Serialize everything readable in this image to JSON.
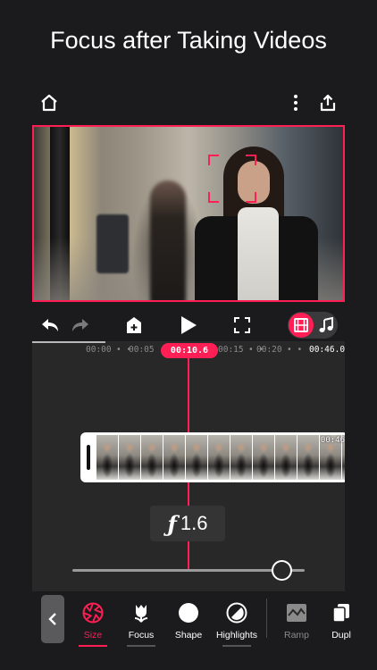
{
  "headline": "Focus after Taking Videos",
  "icons": {
    "home": "home-icon",
    "more": "more-vertical-icon",
    "share": "share-icon",
    "undo": "undo-icon",
    "redo": "redo-icon",
    "add_clip": "add-clip-icon",
    "play": "play-icon",
    "fullscreen": "fullscreen-icon",
    "film": "film-icon",
    "music": "music-note-icon",
    "back": "chevron-left-icon"
  },
  "colors": {
    "accent": "#ff1f55",
    "background": "#1b1b1d",
    "timeline_bg": "#282828"
  },
  "timeline": {
    "ruler": {
      "t0": "00:00",
      "t5": "00:05",
      "t15": "00:15",
      "t20": "00:20",
      "end": "00:46.0"
    },
    "current_time": "00:10.6",
    "clip_duration": "00:46",
    "aperture_symbol": "ƒ",
    "aperture_value": "1.6",
    "slider_value_fraction": 0.92
  },
  "tools": {
    "size": "Size",
    "focus": "Focus",
    "shape": "Shape",
    "highlights": "Highlights",
    "ramp": "Ramp",
    "duplicate": "Dupl"
  },
  "active_tool": "Size"
}
